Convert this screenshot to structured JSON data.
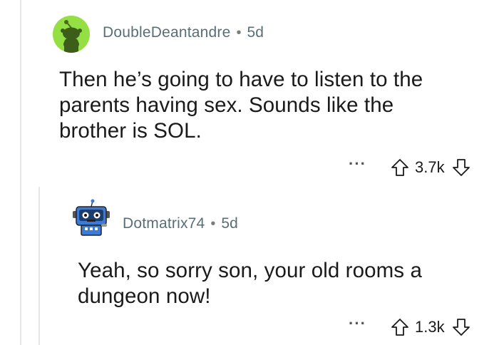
{
  "comments": [
    {
      "username": "DoubleDeantandre",
      "separator": "•",
      "age": "5d",
      "body_lines": [
        "Then he’s going to have to listen to the",
        "parents having sex. Sounds like the",
        "brother is SOL."
      ],
      "more": "···",
      "score": "3.7k",
      "avatar_color": "#94e044",
      "avatar_icon": "snoo-default-avatar"
    },
    {
      "username": "Dotmatrix74",
      "separator": "•",
      "age": "5d",
      "body_lines": [
        "Yeah, so sorry son, your old rooms a",
        "dungeon now!"
      ],
      "more": "···",
      "score": "1.3k",
      "avatar_icon": "robot-avatar"
    }
  ],
  "colors": {
    "thread_line": "#e4e6e8",
    "meta_text": "#576f76",
    "body_text": "#1a1a1b"
  }
}
